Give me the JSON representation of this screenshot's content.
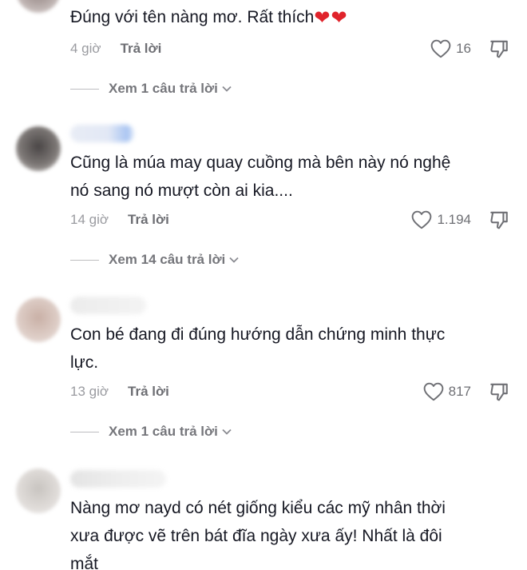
{
  "comments": [
    {
      "text": "Đúng với tên nàng mơ. Rất thích",
      "emoji": "❤❤",
      "time": "4 giờ",
      "reply_label": "Trả lời",
      "likes": "16",
      "view_replies": "Xem 1 câu trả lời"
    },
    {
      "text_lines": [
        "Cũng là múa may quay cuồng mà bên này nó nghệ",
        "nó sang nó mượt còn ai kia...."
      ],
      "time": "14 giờ",
      "reply_label": "Trả lời",
      "likes": "1.194",
      "view_replies": "Xem 14 câu trả lời"
    },
    {
      "text_lines": [
        "Con bé đang đi đúng hướng dẫn chứng minh thực",
        "lực."
      ],
      "time": "13 giờ",
      "reply_label": "Trả lời",
      "likes": "817",
      "view_replies": "Xem 1 câu trả lời"
    },
    {
      "text_lines": [
        "Nàng mơ nayd có nét giống kiểu các mỹ nhân thời",
        "xưa được vẽ trên bát đĩa ngày xưa ấy! Nhất là đôi",
        "mắt"
      ]
    }
  ],
  "icons": {
    "like": "heart-outline-icon",
    "dislike": "thumbs-down-icon",
    "expand": "chevron-down-icon"
  },
  "colors": {
    "text": "#161823",
    "muted": "#8a8b91",
    "emoji_heart": "#e0232b"
  }
}
